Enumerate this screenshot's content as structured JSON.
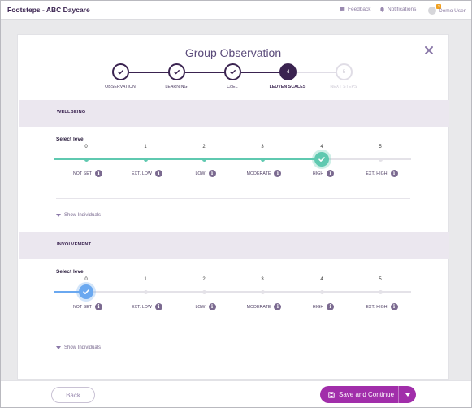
{
  "app": {
    "title": "Footsteps - ABC Daycare"
  },
  "topbar": {
    "feedback_label": "Feedback",
    "notifications_label": "Notifications",
    "notifications_count": "1",
    "user_label": "Demo User"
  },
  "modal": {
    "title": "Group Observation",
    "steps": [
      {
        "label": "OBSERVATION",
        "state": "done"
      },
      {
        "label": "LEARNING",
        "state": "done"
      },
      {
        "label": "CoEL",
        "state": "done"
      },
      {
        "label": "LEUVEN SCALES",
        "state": "active",
        "number": "4"
      },
      {
        "label": "NEXT STEPS",
        "state": "pending",
        "number": "5"
      }
    ]
  },
  "level_labels": [
    "NOT SET",
    "EXT. LOW",
    "LOW",
    "MODERATE",
    "HIGH",
    "EXT. HIGH"
  ],
  "level_numbers": [
    "0",
    "1",
    "2",
    "3",
    "4",
    "5"
  ],
  "sections": {
    "wellbeing": {
      "title": "WELLBEING",
      "select_label": "Select level",
      "selected_level": 4,
      "show_individuals": "Show Individuals",
      "color": "#5fc9b0"
    },
    "involvement": {
      "title": "INVOLVEMENT",
      "select_label": "Select level",
      "selected_level": 0,
      "show_individuals": "Show Individuals",
      "color": "#6aa8f0"
    }
  },
  "footer": {
    "back_label": "Back",
    "save_label": "Save and Continue"
  },
  "colors": {
    "brand_dark": "#3a2350",
    "save_button": "#a12eaa",
    "wellbeing_accent": "#5fc9b0",
    "involvement_accent": "#6aa8f0"
  }
}
